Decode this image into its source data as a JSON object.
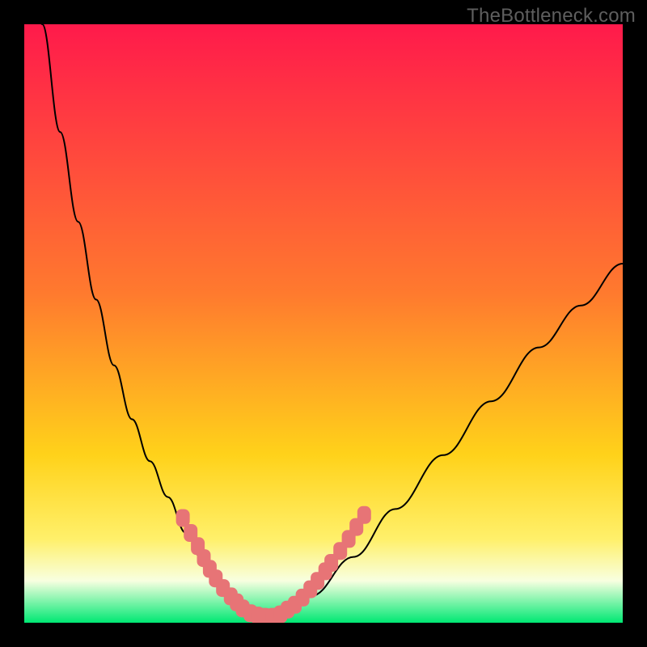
{
  "watermark": "TheBottleneck.com",
  "colors": {
    "bg_black": "#000000",
    "grad_top": "#ff1a4b",
    "grad_mid1": "#ff7a2e",
    "grad_mid2": "#ffd21a",
    "grad_low": "#fff06a",
    "grad_band_light": "#f8ffe0",
    "grad_green": "#00e873",
    "curve_stroke": "#000000",
    "marker_fill": "#e77476"
  },
  "chart_data": {
    "type": "line",
    "title": "",
    "xlabel": "",
    "ylabel": "",
    "xlim": [
      0,
      1
    ],
    "ylim": [
      0,
      1
    ],
    "series": [
      {
        "name": "bottleneck-curve",
        "x": [
          0.0,
          0.03,
          0.06,
          0.09,
          0.12,
          0.15,
          0.18,
          0.21,
          0.24,
          0.27,
          0.3,
          0.33,
          0.36,
          0.38,
          0.4,
          0.43,
          0.48,
          0.55,
          0.62,
          0.7,
          0.78,
          0.86,
          0.93,
          1.0
        ],
        "y": [
          1.2,
          1.0,
          0.82,
          0.67,
          0.54,
          0.43,
          0.34,
          0.27,
          0.21,
          0.15,
          0.1,
          0.06,
          0.03,
          0.012,
          0.01,
          0.015,
          0.045,
          0.11,
          0.19,
          0.28,
          0.37,
          0.46,
          0.53,
          0.6
        ]
      }
    ],
    "markers": {
      "name": "highlighted-points",
      "shape": "rounded-rect",
      "coords": [
        {
          "x": 0.265,
          "y": 0.175
        },
        {
          "x": 0.278,
          "y": 0.15
        },
        {
          "x": 0.29,
          "y": 0.128
        },
        {
          "x": 0.3,
          "y": 0.108
        },
        {
          "x": 0.31,
          "y": 0.09
        },
        {
          "x": 0.32,
          "y": 0.074
        },
        {
          "x": 0.332,
          "y": 0.058
        },
        {
          "x": 0.345,
          "y": 0.044
        },
        {
          "x": 0.355,
          "y": 0.034
        },
        {
          "x": 0.365,
          "y": 0.024
        },
        {
          "x": 0.378,
          "y": 0.016
        },
        {
          "x": 0.39,
          "y": 0.012
        },
        {
          "x": 0.402,
          "y": 0.01
        },
        {
          "x": 0.415,
          "y": 0.01
        },
        {
          "x": 0.428,
          "y": 0.014
        },
        {
          "x": 0.44,
          "y": 0.022
        },
        {
          "x": 0.452,
          "y": 0.03
        },
        {
          "x": 0.465,
          "y": 0.042
        },
        {
          "x": 0.478,
          "y": 0.056
        },
        {
          "x": 0.49,
          "y": 0.07
        },
        {
          "x": 0.503,
          "y": 0.086
        },
        {
          "x": 0.513,
          "y": 0.1
        },
        {
          "x": 0.528,
          "y": 0.12
        },
        {
          "x": 0.542,
          "y": 0.14
        },
        {
          "x": 0.555,
          "y": 0.16
        },
        {
          "x": 0.568,
          "y": 0.18
        }
      ]
    },
    "gradient_bands": [
      {
        "y": 1.0,
        "color": "#ff1a4b"
      },
      {
        "y": 0.55,
        "color": "#ff7a2e"
      },
      {
        "y": 0.3,
        "color": "#ffd21a"
      },
      {
        "y": 0.14,
        "color": "#fff06a"
      },
      {
        "y": 0.08,
        "color": "#f8ffe0"
      },
      {
        "y": 0.0,
        "color": "#00e873"
      }
    ]
  }
}
